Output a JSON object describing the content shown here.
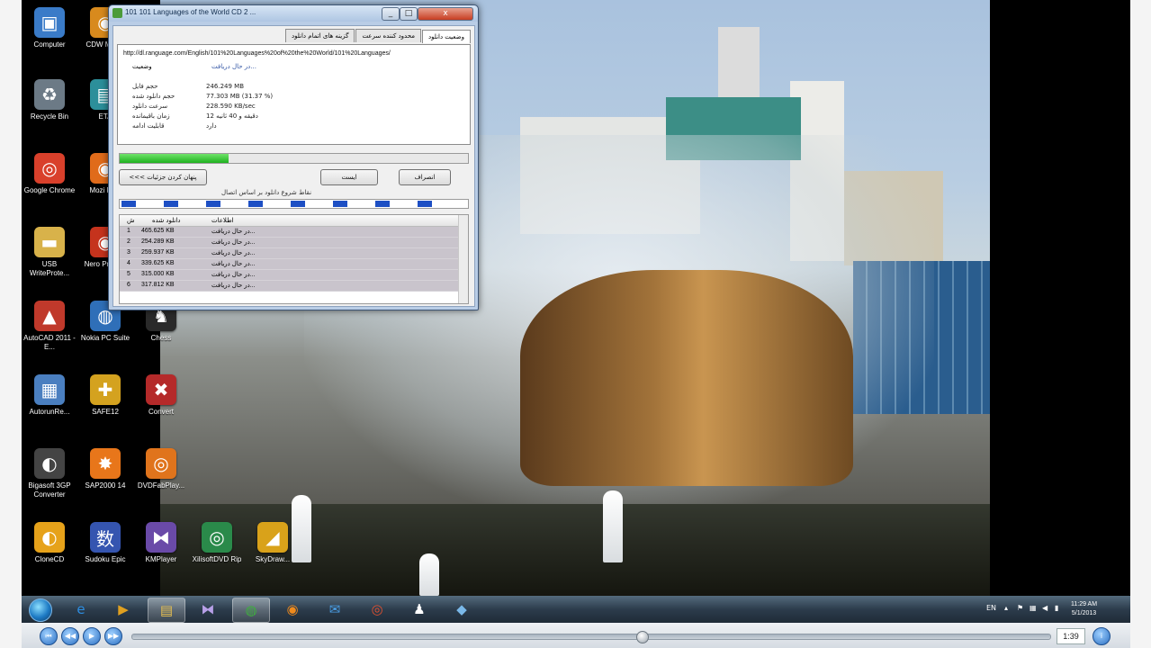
{
  "window": {
    "title": "101 101 Languages of the World CD 2 ...",
    "min": "_",
    "max": "□",
    "close": "x"
  },
  "tabs": [
    "وضعیت دانلود",
    "محدود کننده سرعت",
    "گزینه های اتمام دانلود"
  ],
  "download": {
    "url": "http://dl.ranguage.com/English/101%20Languages%20of%20the%20World/101%20Languages/",
    "status_label": "وضعیت",
    "status_value": "در حال دریافت...",
    "info": [
      {
        "label": "حجم فایل",
        "value": "246.249 MB"
      },
      {
        "label": "حجم دانلود شده",
        "value": "77.303 MB (31.37 %)"
      },
      {
        "label": "سرعت دانلود",
        "value": "228.590 KB/sec"
      },
      {
        "label": "زمان باقیمانده",
        "value": "12 دقیقه و 40 ثانیه"
      },
      {
        "label": "قابلیت ادامه",
        "value": "دارد"
      }
    ],
    "progress_percent": 31.37
  },
  "buttons": {
    "details": "<<< پنهان کردن جزئیات",
    "pause": "ایست",
    "cancel": "انصراف"
  },
  "segments_caption": "نقاط شروع دانلود بر اساس اتصال",
  "list": {
    "headers": [
      "ش",
      "دانلود شده",
      "اطلاعات"
    ],
    "rows": [
      {
        "n": "1",
        "size": "465.625 KB",
        "info": "در حال دریافت..."
      },
      {
        "n": "2",
        "size": "254.289 KB",
        "info": "در حال دریافت..."
      },
      {
        "n": "3",
        "size": "259.937 KB",
        "info": "در حال دریافت..."
      },
      {
        "n": "4",
        "size": "339.625 KB",
        "info": "در حال دریافت..."
      },
      {
        "n": "5",
        "size": "315.000 KB",
        "info": "در حال دریافت..."
      },
      {
        "n": "6",
        "size": "317.812 KB",
        "info": "در حال دریافت..."
      }
    ]
  },
  "desktop_icons": [
    {
      "label": "Computer",
      "icon": "computer-icon",
      "color": "#3a7bc8"
    },
    {
      "label": "CDW Media",
      "icon": "disc-icon",
      "color": "#d88a1d"
    },
    {
      "label": "Recycle Bin",
      "icon": "recycle-bin-icon",
      "color": "#6c7a86"
    },
    {
      "label": "ETA",
      "icon": "app-icon",
      "color": "#2c8f9a"
    },
    {
      "label": "Google Chrome",
      "icon": "chrome-icon",
      "color": "#d9402b"
    },
    {
      "label": "Mozi Firef",
      "icon": "firefox-icon",
      "color": "#e06b1a"
    },
    {
      "label": "USB WriteProte...",
      "icon": "folder-icon",
      "color": "#d8b24a"
    },
    {
      "label": "Nero Profess",
      "icon": "nero-icon",
      "color": "#c5331d"
    },
    {
      "label": "AutoCAD 2011 - E...",
      "icon": "autocad-icon",
      "color": "#c0392b"
    },
    {
      "label": "Nokia PC Suite",
      "icon": "nokia-icon",
      "color": "#2f6fb8"
    },
    {
      "label": "Chess",
      "icon": "chess-icon",
      "color": "#2a2a2a"
    },
    {
      "label": "AutorunRe...",
      "icon": "autorun-icon",
      "color": "#4a7fc0"
    },
    {
      "label": "SAFE12",
      "icon": "safe-icon",
      "color": "#d4a21f"
    },
    {
      "label": "Convert",
      "icon": "converter-icon",
      "color": "#b52a2a"
    },
    {
      "label": "Bigasoft 3GP Converter",
      "icon": "bigasoft-icon",
      "color": "#444"
    },
    {
      "label": "SAP2000 14",
      "icon": "sap-icon",
      "color": "#e8761a"
    },
    {
      "label": "DVDFabPlay...",
      "icon": "dvdfab-icon",
      "color": "#e0741c"
    },
    {
      "label": "CloneCD",
      "icon": "clonecd-icon",
      "color": "#e6a21a"
    },
    {
      "label": "Sudoku Epic",
      "icon": "sudoku-icon",
      "color": "#3555b0"
    },
    {
      "label": "KMPlayer",
      "icon": "kmplayer-icon",
      "color": "#6a4aa8"
    },
    {
      "label": "XilisoftDVD Rip",
      "icon": "xilisoft-icon",
      "color": "#2a8a4a"
    },
    {
      "label": "SkyDraw...",
      "icon": "skydraw-icon",
      "color": "#d9a21a"
    }
  ],
  "taskbar": {
    "items": [
      {
        "name": "ie-icon",
        "glyph": "e",
        "color": "#2d8de0"
      },
      {
        "name": "media-player-icon",
        "glyph": "▶",
        "color": "#e0a020"
      },
      {
        "name": "explorer-icon",
        "glyph": "▤",
        "color": "#e8c050"
      },
      {
        "name": "kmplayer-icon",
        "glyph": "⧓",
        "color": "#b8a0e8"
      },
      {
        "name": "globe-icon",
        "glyph": "◍",
        "color": "#3fae3f"
      },
      {
        "name": "firefox-icon",
        "glyph": "◉",
        "color": "#f08a1c"
      },
      {
        "name": "messenger-icon",
        "glyph": "✉",
        "color": "#4aa0e8"
      },
      {
        "name": "chrome-icon",
        "glyph": "◎",
        "color": "#e05030"
      },
      {
        "name": "tux-icon",
        "glyph": "♟",
        "color": "#ffffff"
      },
      {
        "name": "app-icon",
        "glyph": "◆",
        "color": "#7ab8e8"
      }
    ],
    "lang": "EN",
    "time": "11:29 AM",
    "date": "5/1/2013"
  },
  "player": {
    "time": "1:39",
    "position": 0.555
  }
}
